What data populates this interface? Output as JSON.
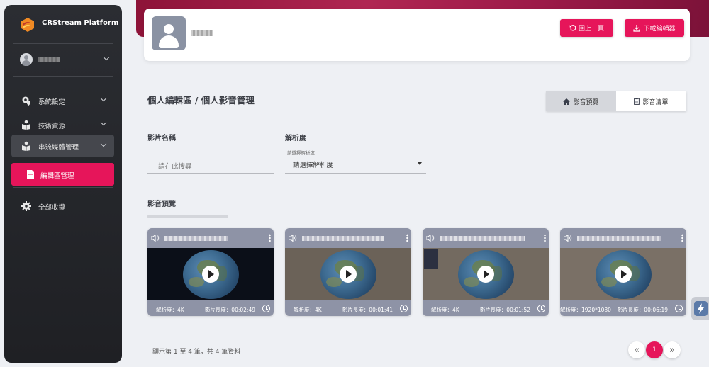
{
  "sidebar": {
    "brand_title": "CRStream Platform",
    "items": [
      {
        "label": "系統設定",
        "icon": "gear-shield-icon"
      },
      {
        "label": "技術資源",
        "icon": "book-user-icon"
      },
      {
        "label": "串流媒體管理",
        "icon": "book-user-icon"
      },
      {
        "label": "編輯區管理",
        "icon": "document-icon"
      },
      {
        "label": "全部收攏",
        "icon": "gear-icon"
      }
    ]
  },
  "header": {
    "back_button": "回上一頁",
    "download_button": "下載編輯器"
  },
  "main": {
    "title": "個人編輯區 / 個人影音管理",
    "tabs": [
      {
        "label": "影音預覽",
        "active": true
      },
      {
        "label": "影音清單",
        "active": false
      }
    ],
    "filters": {
      "name_label": "影片名稱",
      "name_placeholder": "請在此搜尋",
      "resolution_label": "解析度",
      "resolution_caption": "請選擇解析度",
      "resolution_value": "請選擇解析度"
    },
    "section_title": "影音預覽",
    "videos": [
      {
        "resolution": "解析度：4K",
        "duration": "影片長度：00:02:49"
      },
      {
        "resolution": "解析度：4K",
        "duration": "影片長度：00:01:41"
      },
      {
        "resolution": "解析度：4K",
        "duration": "影片長度：00:01:52"
      },
      {
        "resolution": "解析度：1920*1080",
        "duration": "影片長度：00:06:19"
      }
    ],
    "records_text": "顯示第 1 至 4 筆，共 4 筆資料",
    "pagination": {
      "prev": "«",
      "current": "1",
      "next": "»"
    }
  },
  "colors": {
    "accent": "#e6155a",
    "sidebar_bg": "#2b2d32",
    "card_bg": "#8e93a6"
  }
}
